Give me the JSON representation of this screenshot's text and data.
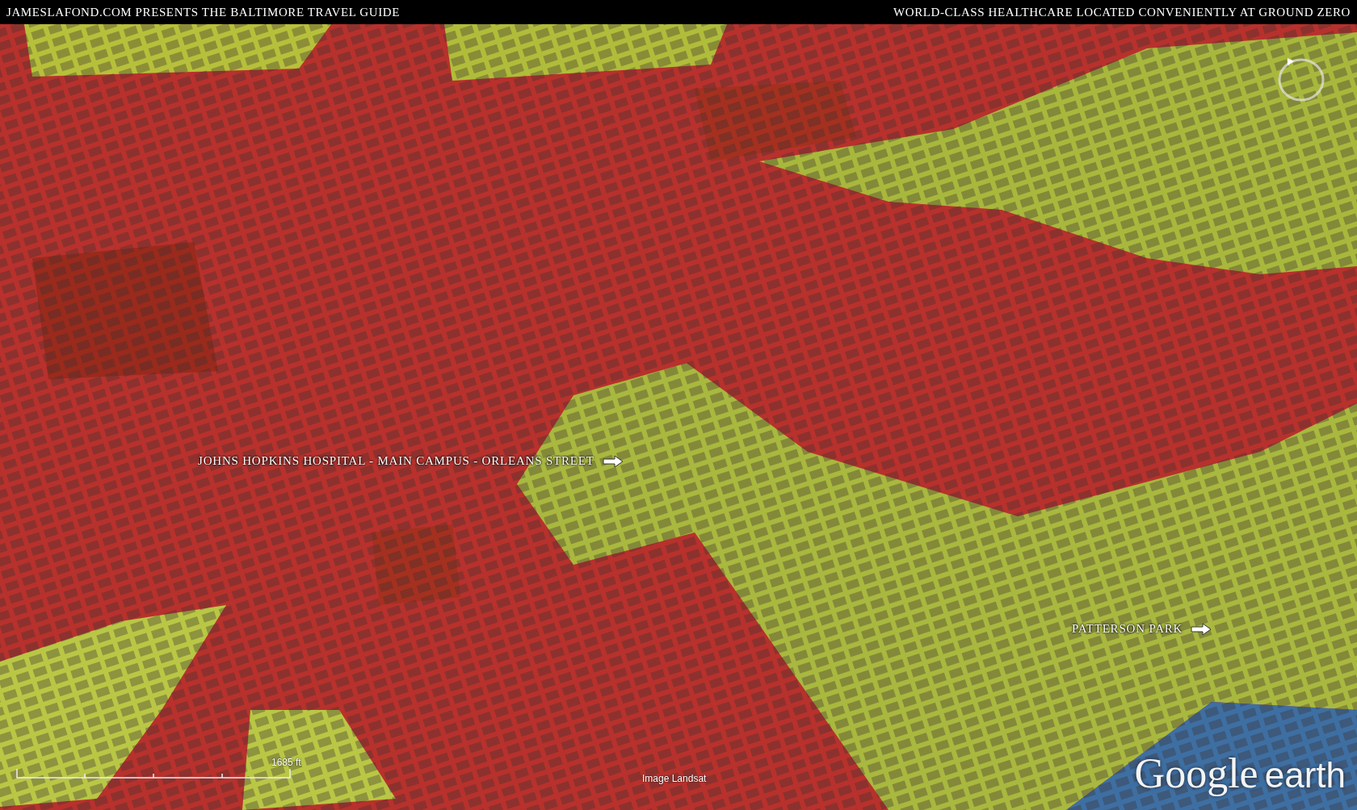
{
  "header": {
    "left": "JAMESLAFOND.COM PRESENTS THE BALTIMORE TRAVEL GUIDE",
    "right": "WORLD-CLASS HEALTHCARE LOCATED CONVENIENTLY AT GROUND ZERO"
  },
  "map": {
    "labels": [
      {
        "text": "JOHNS HOPKINS HOSPITAL - MAIN CAMPUS - ORLEANS STREET",
        "kind": "arrow"
      },
      {
        "text": "PATTERSON PARK",
        "kind": "arrow"
      }
    ],
    "scale": "1685 ft",
    "credit": "Image Landsat",
    "logo": {
      "brand": "Google",
      "product": "earth"
    }
  }
}
